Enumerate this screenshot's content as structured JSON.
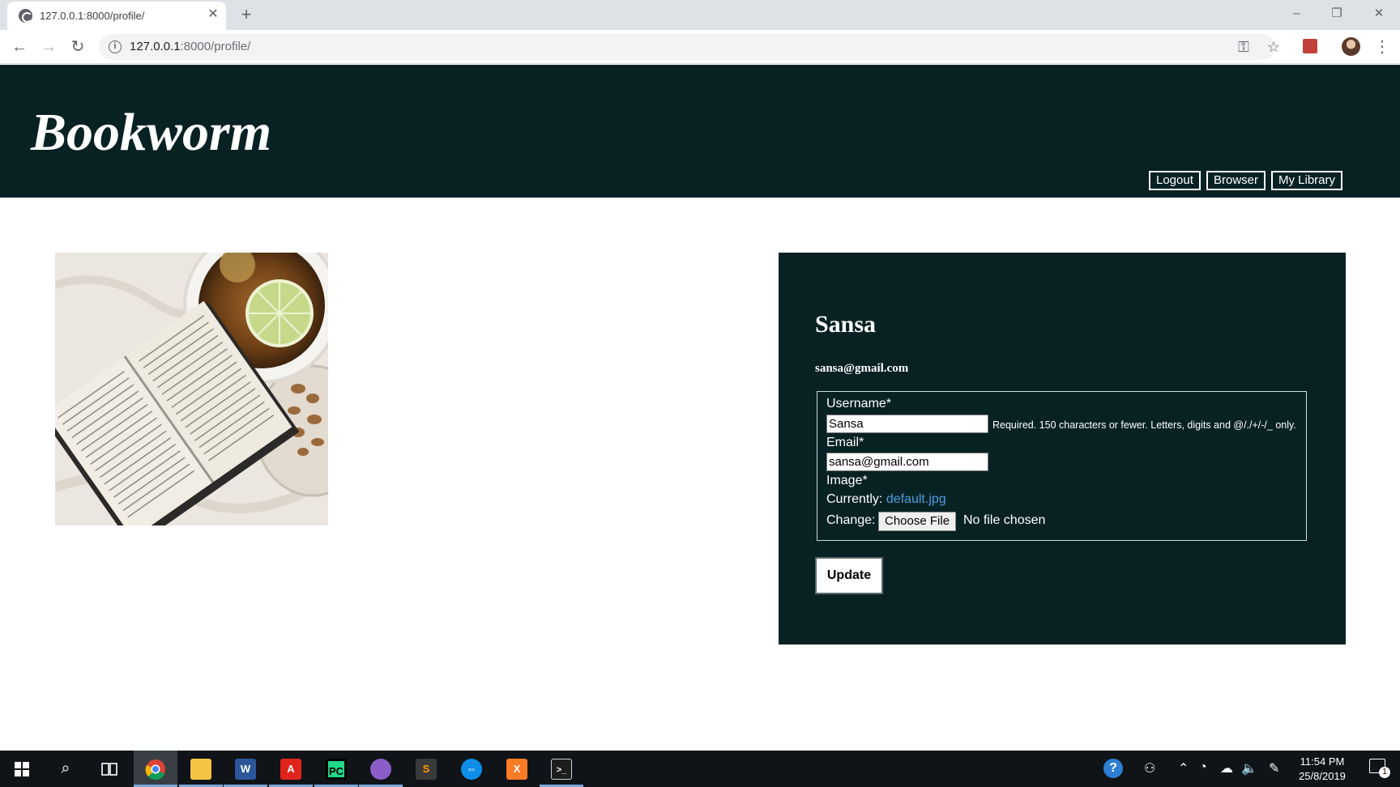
{
  "browser": {
    "tab_title": "127.0.0.1:8000/profile/",
    "url_host": "127.0.0.1",
    "url_rest": ":8000/profile/",
    "icons": [
      "globe-icon",
      "close-icon",
      "plus-icon",
      "back-icon",
      "forward-icon",
      "reload-icon",
      "info-icon",
      "key-icon",
      "star-icon",
      "pdf-extension-icon",
      "profile-avatar",
      "menu-icon"
    ]
  },
  "header": {
    "brand": "Bookworm",
    "nav": {
      "logout": "Logout",
      "browser": "Browser",
      "library": "My Library"
    },
    "background": "#082224"
  },
  "profile": {
    "username": "Sansa",
    "email": "sansa@gmail.com",
    "form": {
      "username_label": "Username*",
      "username_value": "Sansa",
      "username_help": "Required. 150 characters or fewer. Letters, digits and @/./+/-/_ only.",
      "email_label": "Email*",
      "email_value": "sansa@gmail.com",
      "image_label": "Image*",
      "currently_label": "Currently:",
      "current_file": "default.jpg",
      "change_label": "Change:",
      "choose_file": "Choose File",
      "no_file": "No file chosen"
    },
    "update_label": "Update"
  },
  "taskbar": {
    "time": "11:54 PM",
    "date": "25/8/2019",
    "notification_count": "1",
    "apps": [
      "windows-start-icon",
      "search-icon",
      "task-view-icon",
      "chrome-icon",
      "file-explorer-icon",
      "word-icon",
      "acrobat-icon",
      "pycharm-icon",
      "github-desktop-icon",
      "sublime-text-icon",
      "teamviewer-icon",
      "xampp-icon",
      "terminal-icon"
    ]
  }
}
